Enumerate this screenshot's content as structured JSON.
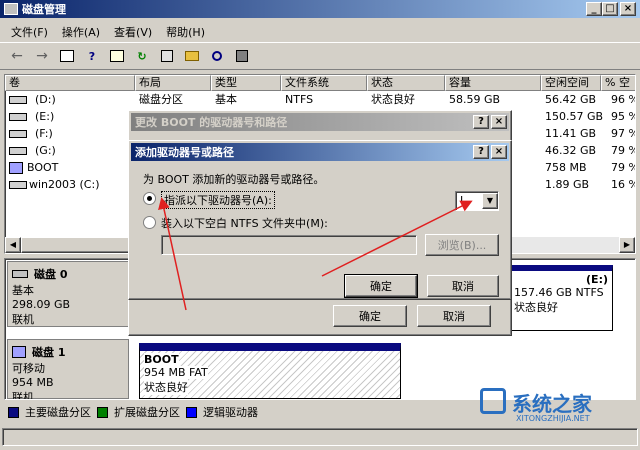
{
  "window": {
    "title": "磁盘管理",
    "min": "_",
    "max": "□",
    "close": "×"
  },
  "menu": [
    "文件(F)",
    "操作(A)",
    "查看(V)",
    "帮助(H)"
  ],
  "columns": [
    "卷",
    "布局",
    "类型",
    "文件系统",
    "状态",
    "容量",
    "空闲空间",
    "% 空"
  ],
  "volumes": [
    {
      "name": "(D:)",
      "layout": "磁盘分区",
      "type": "基本",
      "fs": "NTFS",
      "status": "状态良好",
      "capacity": "58.59 GB",
      "free": "56.42 GB",
      "pct": "96 %"
    },
    {
      "name": "(E:)",
      "layout": "",
      "type": "",
      "fs": "",
      "status": "",
      "capacity": "",
      "free": "150.57 GB",
      "pct": "95 %"
    },
    {
      "name": "(F:)",
      "layout": "",
      "type": "",
      "fs": "",
      "status": "",
      "capacity": "",
      "free": "11.41 GB",
      "pct": "97 %"
    },
    {
      "name": "(G:)",
      "layout": "",
      "type": "",
      "fs": "",
      "status": "",
      "capacity": "",
      "free": "46.32 GB",
      "pct": "79 %"
    },
    {
      "name": "BOOT",
      "layout": "",
      "type": "",
      "fs": "",
      "status": "",
      "capacity": "",
      "free": "758 MB",
      "pct": "79 %"
    },
    {
      "name": "win2003 (C:)",
      "layout": "",
      "type": "",
      "fs": "",
      "status": "",
      "capacity": "",
      "free": "1.89 GB",
      "pct": "16 %"
    }
  ],
  "disks": [
    {
      "label": "磁盘 0",
      "type": "基本",
      "size": "298.09 GB",
      "state": "联机"
    },
    {
      "label": "磁盘 1",
      "type": "可移动",
      "size": "954 MB",
      "state": "联机"
    }
  ],
  "disk0_partition": {
    "name": "(E:)",
    "info": "157.46 GB NTFS",
    "status": "状态良好"
  },
  "disk1_partition": {
    "name": "BOOT",
    "info": "954 MB FAT",
    "status": "状态良好"
  },
  "legend": [
    "主要磁盘分区",
    "扩展磁盘分区",
    "逻辑驱动器"
  ],
  "colors": {
    "primary": "#0a0a80",
    "extended": "#008000",
    "logical": "#0000ff",
    "arrow": "#e02020"
  },
  "outer_dialog": {
    "title": "更改 BOOT 的驱动器号和路径",
    "help": "?",
    "close": "×",
    "ok": "确定",
    "cancel": "取消"
  },
  "inner_dialog": {
    "title": "添加驱动器号或路径",
    "help": "?",
    "close": "×",
    "instruction": "为 BOOT 添加新的驱动器号或路径。",
    "option_letter": "指派以下驱动器号(A):",
    "option_folder": "装入以下空白 NTFS 文件夹中(M):",
    "drive_letter": "I",
    "browse": "浏览(B)...",
    "ok": "确定",
    "cancel": "取消"
  },
  "watermark": {
    "text": "系统之家",
    "url": "XITONGZHIJIA.NET"
  }
}
